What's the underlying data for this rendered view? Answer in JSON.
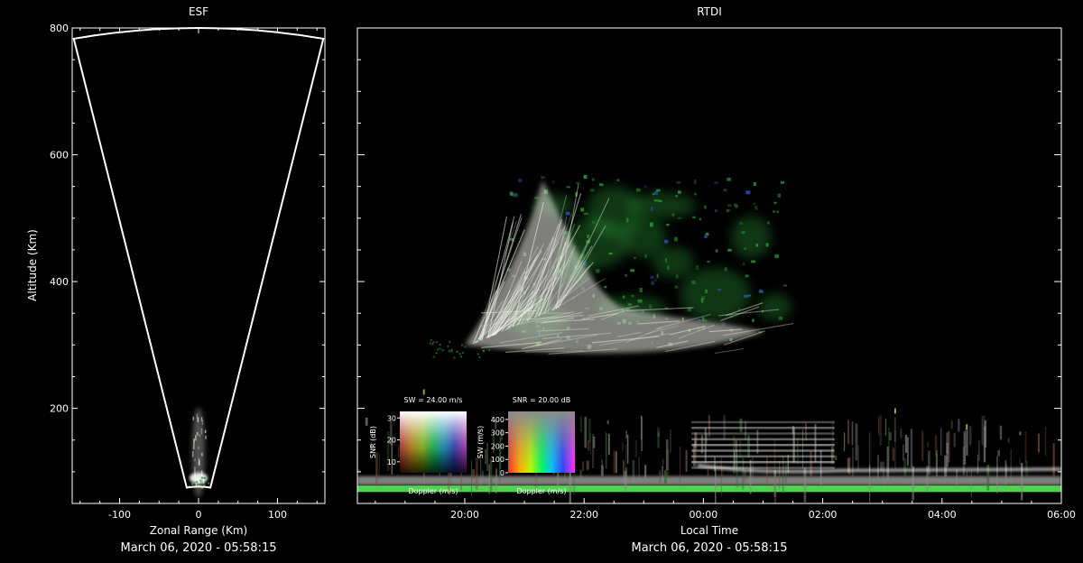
{
  "chart_data": [
    {
      "type": "heatmap",
      "title": "ESF",
      "xlabel": "Zonal Range (Km)",
      "ylabel": "Altitude (Km)",
      "xlim": [
        -160,
        160
      ],
      "ylim": [
        50,
        800
      ],
      "x_ticks": [
        -100,
        0,
        100
      ],
      "y_ticks": [
        200,
        400,
        600,
        800
      ],
      "fan": {
        "apex_altitude": 75,
        "apex_half_width": 15,
        "rim_altitude_center": 800,
        "rim_altitude_edge": 783,
        "rim_range": 158
      },
      "timestamp": "March 06, 2020 - 05:58:15"
    },
    {
      "type": "heatmap",
      "title": "RTDI",
      "xlabel": "Local Time",
      "ylabel": "",
      "xlim_hours": [
        18.2,
        30
      ],
      "ylim": [
        50,
        800
      ],
      "x_tick_values": [
        20,
        22,
        24,
        26,
        28,
        30
      ],
      "x_tick_labels": [
        "20:00",
        "22:00",
        "00:00",
        "02:00",
        "04:00",
        "06:00"
      ],
      "timestamp": "March 06, 2020 - 05:58:15"
    }
  ],
  "legends": {
    "doppler_snr": {
      "title": "SW = 24.00 m/s",
      "xlabel": "Doppler (m/s)",
      "ylabel": "SNR (dB)",
      "y_ticks": [
        10,
        20,
        30
      ],
      "ylim": [
        5,
        33
      ]
    },
    "doppler_sw": {
      "title": "SNR = 20.00 dB",
      "xlabel": "Doppler (m/s)",
      "ylabel": "SW (m/s)",
      "y_ticks": [
        0,
        100,
        200,
        300,
        400
      ],
      "ylim": [
        0,
        460
      ]
    }
  },
  "colors": {
    "background": "#000000",
    "axis": "#ffffff",
    "echo_white": "#e6e6e0",
    "echo_green": "#2e9e3a",
    "ground_band": "#4ee04e"
  }
}
